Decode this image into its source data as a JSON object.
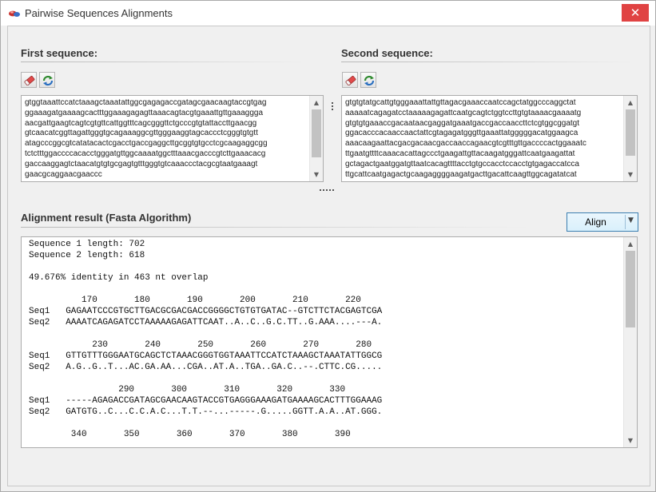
{
  "window": {
    "title": "Pairwise Sequences Alignments",
    "close_glyph": "✕"
  },
  "first": {
    "label": "First sequence:",
    "lines": [
      "gtggtaaattccatctaaagctaaatattggcgagagaccgatagcgaacaagtaccgtgag",
      "ggaaagatgaaaagcactttggaaagagagttaaacagtacgtgaaattgttgaaaggga",
      "aacgattgaagtcagtcgtgttcattggtttcagcgggttctgcccgtgtattaccttgaacgg",
      "gtcaacatcggttagattgggtgcagaaaggcgttgggaaggtagcaccctcgggtgtgtt",
      "atagcccggcgtcatatacactcgacctgaccgaggcttgcggtgtgcctcgcaagaggcgg",
      "tctctttggaccccacacctgggatgttggcaaaatggctttaaacgacccgtcttgaaacacg",
      "gaccaaggagtctaacatgtgtgcgagtgtttgggtgtcaaaccctacgcgtaatgaaagt",
      "gaacgcaggaacgaaccc"
    ]
  },
  "second": {
    "label": "Second sequence:",
    "lines": [
      "gtgtgtatgcattgtgggaaattattgttagacgaaaccaatccagctatggcccaggctat",
      "aaaaatcagagatcctaaaaagagattcaatgcagtctggtccttgtgtaaaacgaaaatg",
      "gtgtgtgaaaccgacaataacgaggatgaaatgaccgaccaaccttctcgtggcggatgt",
      "ggacacccacaaccaactattcgtagagatgggttgaaattatgggggacatggaagca",
      "aaacaagaattacgacgacaacgaccaaccagaacgtcgtttgttgaccccactggaaatc",
      "ttgaatgttttcaaacacattagccctgaagattgttacaagatgggattcaatgaagattat",
      "gctagactgaatggatgttaatcacagttttacctgtgccacctccacctgtgagaccatcca",
      "ttgcattcaatgagactgcaagaggggaagatgacttgacattcaagttggcagatatcat"
    ]
  },
  "result": {
    "label": "Alignment result (Fasta Algorithm)",
    "align_button": "Align",
    "dropdown_glyph": "▼",
    "lines": [
      "Sequence 1 length: 702",
      "Sequence 2 length: 618",
      "",
      "49.676% identity in 463 nt overlap",
      "",
      "          170       180       190       200       210       220",
      "Seq1   GAGAATCCCGTGCTTGACGCGACGACCGGGGCTGTGTGATAC--GTCTTCTACGAGTCGA",
      "Seq2   AAAATCAGAGATCCTAAAAAGAGATTCAAT..A..C..G.C.TT..G.AAA....---A.",
      "",
      "            230       240       250       260       270       280",
      "Seq1   GTTGTTTGGGAATGCAGCTCTAAACGGGTGGTAAATTCCATCTAAAGCTAAATATTGGCG",
      "Seq2   A.G..G..T...AC.GA.AA...CGA..AT.A..TGA..GA.C..--.CTTC.CG.....",
      "",
      "                 290       300       310       320       330",
      "Seq1   -----AGAGACCGATAGCGAACAAGTACCGTGAGGGAAAGATGAAAAGCACTTTGGAAAG",
      "Seq2   GATGTG..C...C.C.A.C...T.T.--...-----.G.....GGTT.A.A..AT.GGG.",
      "",
      "        340       350       360       370       380       390"
    ]
  },
  "icons": {
    "app": "sequence-logo-icon",
    "clear": "eraser-icon",
    "swap": "refresh-icon",
    "scroll_up": "▲",
    "scroll_down": "▼",
    "splitter_vertical": "⋮",
    "splitter_horizontal": "·····"
  }
}
